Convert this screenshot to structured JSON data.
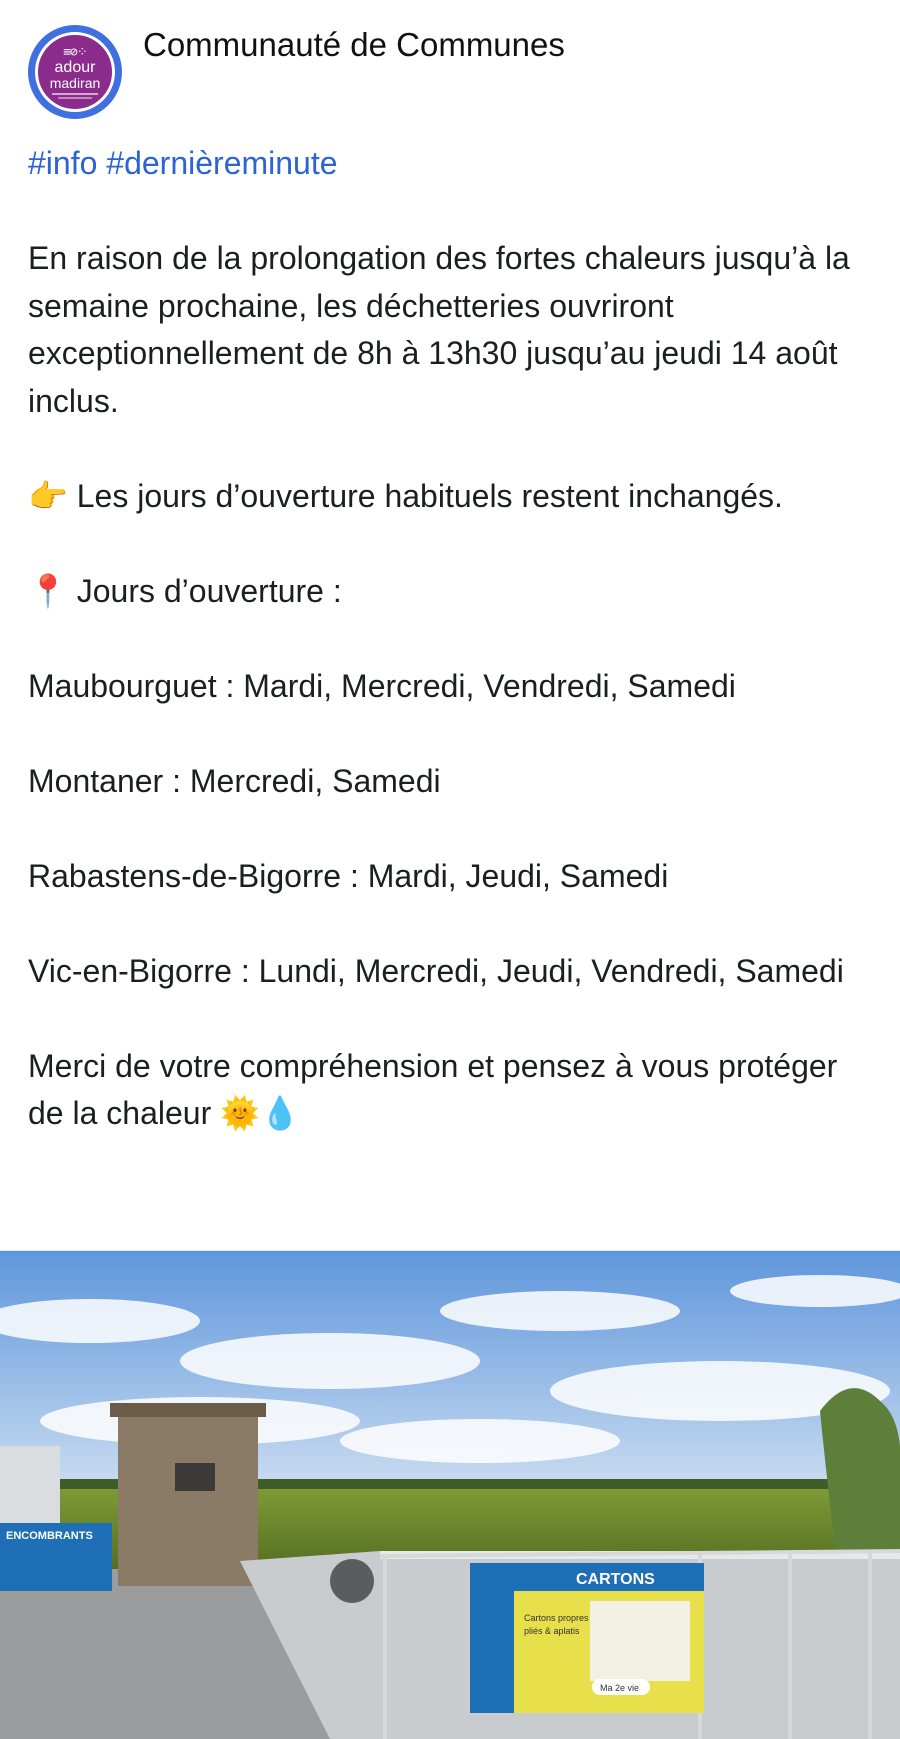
{
  "post": {
    "author": "Communauté de Communes",
    "avatar_logo": {
      "line1": "adour",
      "line2": "madiran"
    },
    "hashtags": "#info #dernièreminute",
    "paragraph1": "En raison de la prolongation des fortes chaleurs jusqu’à la semaine prochaine, les déchetteries ouvriront exceptionnellement de 8h à 13h30 jusqu’au jeudi 14 août inclus.",
    "point_emoji": "👉",
    "paragraph2": "Les jours d’ouverture habituels restent inchangés.",
    "pin_emoji": "📍",
    "opening_heading": "Jours d’ouverture :",
    "sites": [
      {
        "name": "Maubourguet",
        "days": "Mardi, Mercredi, Vendredi, Samedi"
      },
      {
        "name": "Montaner",
        "days": "Mercredi, Samedi"
      },
      {
        "name": "Rabastens-de-Bigorre",
        "days": "Mardi, Jeudi, Samedi"
      },
      {
        "name": "Vic-en-Bigorre",
        "days": "Lundi, Mercredi, Jeudi, Vendredi, Samedi"
      }
    ],
    "closing": "Merci de votre compréhension et pensez à vous protéger de la chaleur",
    "closing_emojis": "🌞💧"
  },
  "photo": {
    "sign_left": "ENCOMBRANTS",
    "sign_right_title": "CARTONS",
    "sign_right_line1": "Cartons propres",
    "sign_right_line2": "pliés & aplatis",
    "sign_right_badge": "Ma 2e vie"
  },
  "colors": {
    "hashtag": "#2c63d6",
    "avatar_ring": "#3f6fe0",
    "avatar_fill": "#8b2b8c",
    "sky": "#6fa3e0",
    "field": "#6f8a2c",
    "sign_blue": "#1f6fb7",
    "sign_yellow": "#e8e04a"
  },
  "icons": [
    "point-right-icon",
    "pin-icon",
    "sun-icon",
    "droplet-icon"
  ]
}
